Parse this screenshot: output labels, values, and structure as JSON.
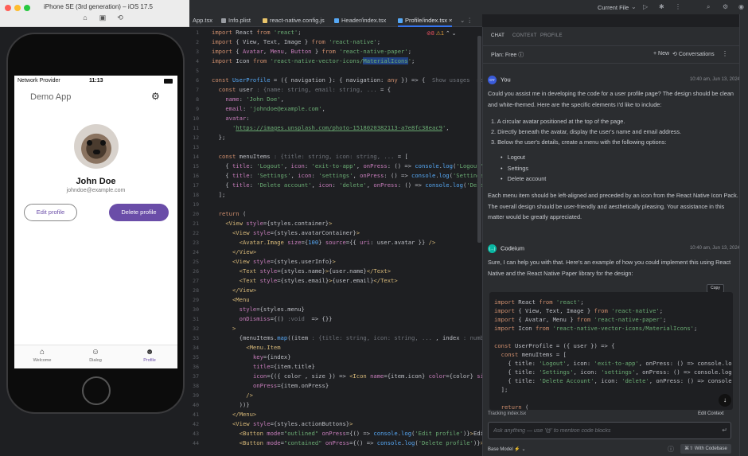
{
  "simulator": {
    "title": "iPhone SE (3rd generation) – iOS 17.5",
    "tool_icons": [
      "home-icon",
      "screenshot-icon",
      "rotate-icon"
    ],
    "status_bar": {
      "provider": "Network Provider",
      "time": "11:13"
    },
    "app_title": "Demo App",
    "user": {
      "name": "John Doe",
      "email": "johndoe@example.com"
    },
    "buttons": {
      "edit": "Edit profile",
      "delete": "Delete profile"
    },
    "tabs": [
      {
        "label": "Welcome",
        "icon": "home-icon"
      },
      {
        "label": "Dialog",
        "icon": "dialog-icon"
      },
      {
        "label": "Profile",
        "icon": "profile-icon",
        "active": true
      }
    ]
  },
  "header": {
    "current_file": "Current File",
    "colors": {
      "accent": "#3574f0"
    }
  },
  "editor": {
    "tabs": [
      {
        "label": "App.tsx",
        "color": "#56a8f5"
      },
      {
        "label": "Info.plist",
        "color": "#9a9da3"
      },
      {
        "label": "react-native.config.js",
        "color": "#e8c46a"
      },
      {
        "label": "Header/index.tsx",
        "color": "#56a8f5"
      },
      {
        "label": "Profile/index.tsx",
        "color": "#56a8f5",
        "active": true
      }
    ],
    "problems": {
      "errors": "8",
      "warnings": "1"
    },
    "line_numbers": [
      "1",
      "2",
      "3",
      "4",
      "5",
      "6",
      "7",
      "8",
      "9",
      "10",
      "11",
      "12",
      "13",
      "14",
      "15",
      "16",
      "17",
      "18",
      "19",
      "20",
      "21",
      "22",
      "23",
      "24",
      "25",
      "26",
      "27",
      "28",
      "29",
      "30",
      "31",
      "32",
      "33",
      "34",
      "35",
      "36",
      "37",
      "38",
      "39",
      "40",
      "41",
      "42",
      "43",
      "44"
    ],
    "inlay_usages": "Show usages",
    "inlay_new": "new *"
  },
  "panel": {
    "tabs": [
      "CHAT",
      "CONTEXT",
      "PROFILE"
    ],
    "plan": "Plan: Free",
    "new_label": "+ New",
    "conversations_label": "Conversations",
    "user_message": {
      "author": "You",
      "initials": "OY",
      "time": "10:40 am, Jun 13, 2024",
      "intro": "Could you assist me in developing the code for a user profile page? The design should be clean and white-themed. Here are the specific elements I'd like to include:",
      "steps": [
        "1.  A circular avatar positioned at the top of the page.",
        "2.  Directly beneath the avatar, display the user's name and email address.",
        "3.  Below the user's details, create a menu with the following options:"
      ],
      "options": [
        "Logout",
        "Settings",
        "Delete account"
      ],
      "outro": "Each menu item should be left-aligned and preceded by an icon from the React Native Icon Pack. The overall design should be user-friendly and aesthetically pleasing. Your assistance in this matter would be greatly appreciated."
    },
    "bot_message": {
      "author": "Codeium",
      "time": "10:40 am, Jun 13, 2024",
      "intro": "Sure, I can help you with that. Here's an example of how you could implement this using React Native and the React Native Paper library for the design:",
      "copy_label": "Copy"
    },
    "tracking": "Tracking index.tsx",
    "edit_context": "Edit Context",
    "ask_placeholder": "Ask anything — use '@' to mention code blocks",
    "base_model": "Base Model ⚡",
    "with_codebase": "⌘⇧ With Codebase"
  }
}
